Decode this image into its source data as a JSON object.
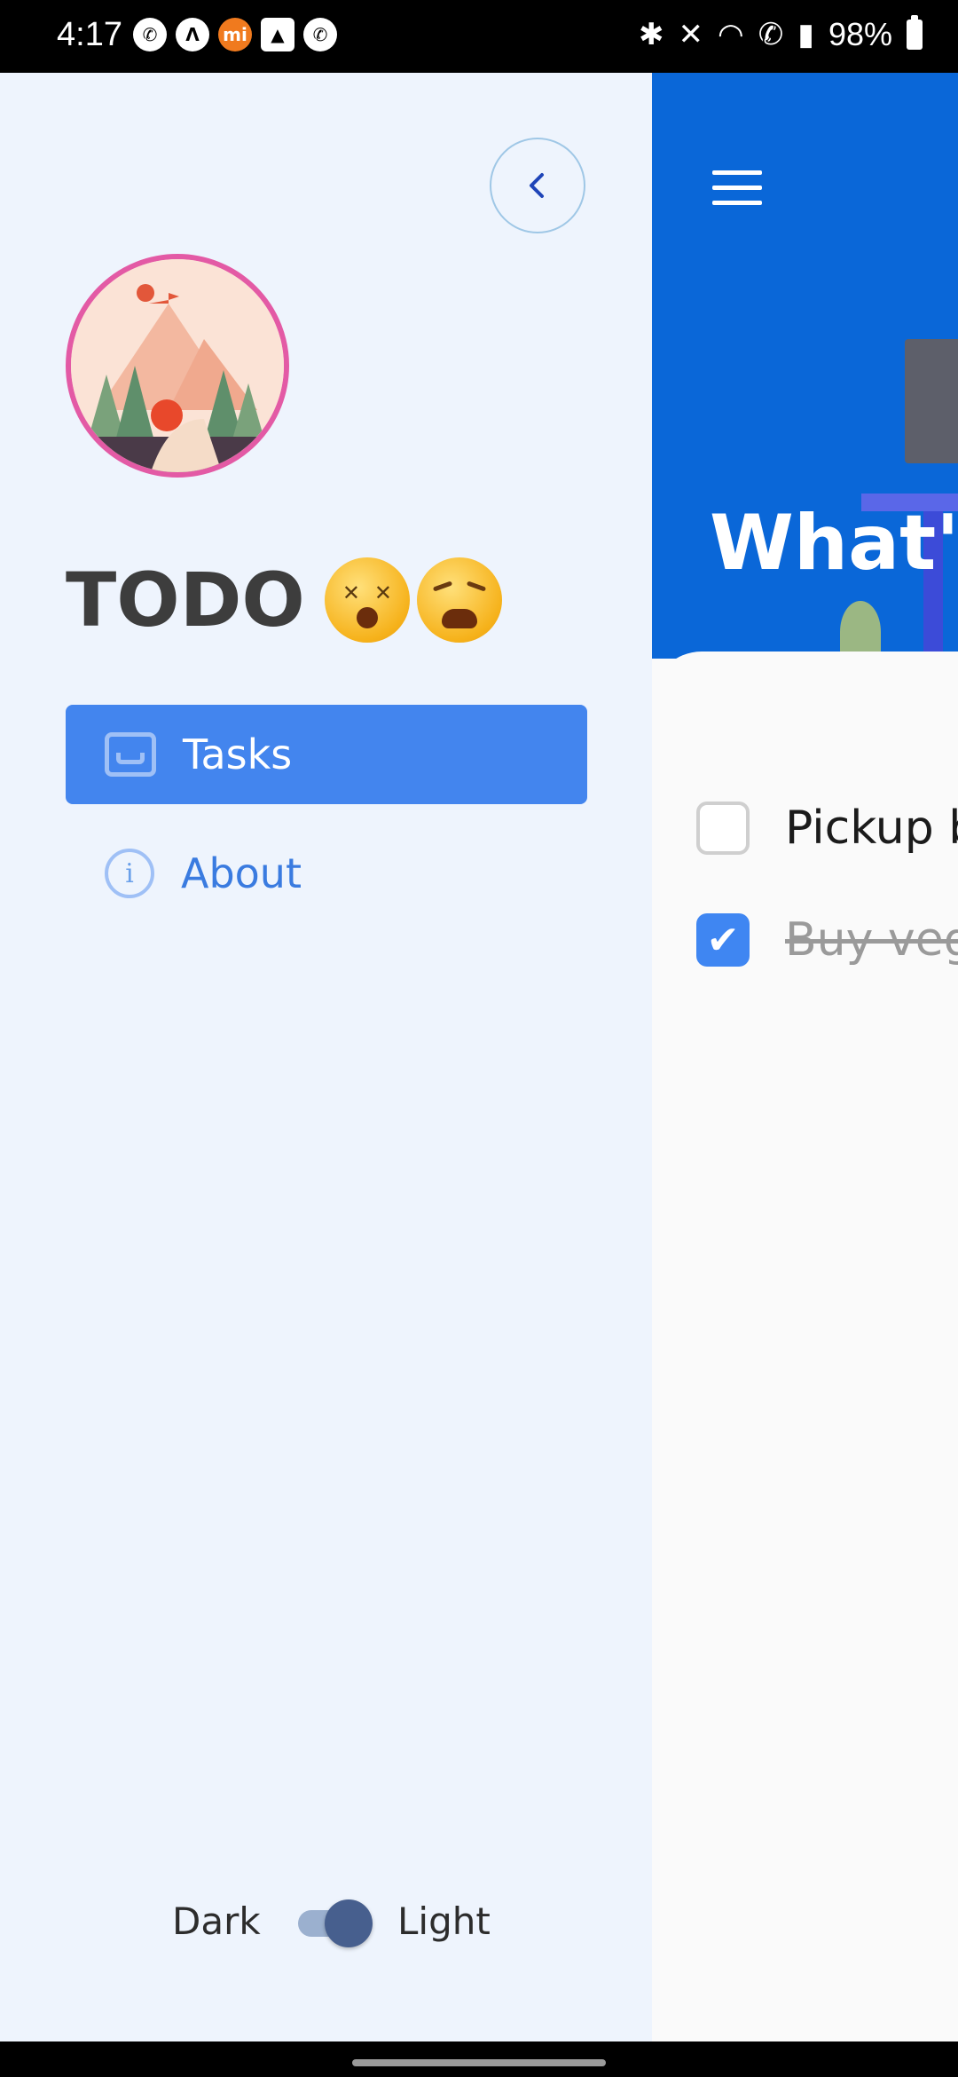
{
  "status_bar": {
    "time": "4:17",
    "battery": "98%",
    "left_icons": [
      "whatsapp-icon",
      "app-icon",
      "mi-icon",
      "gallery-icon",
      "phone-icon"
    ],
    "right_icons": [
      "bluetooth-icon",
      "mute-icon",
      "wifi-icon",
      "wifi-call-icon",
      "signal-icon",
      "battery-icon"
    ]
  },
  "drawer": {
    "title": "TODO",
    "emojis": [
      "dizzy-face-emoji",
      "weary-face-emoji"
    ],
    "back_icon": "chevron-left-icon",
    "nav": [
      {
        "label": "Tasks",
        "icon": "inbox-icon",
        "active": true
      },
      {
        "label": "About",
        "icon": "info-icon",
        "active": false
      }
    ],
    "theme": {
      "dark_label": "Dark",
      "light_label": "Light",
      "value": "light"
    }
  },
  "main": {
    "header_text": "What's",
    "tasks": [
      {
        "label": "Pickup b",
        "done": false
      },
      {
        "label": "Buy veg",
        "done": true
      }
    ]
  },
  "colors": {
    "accent": "#4385EE",
    "header_blue": "#0A67D8",
    "drawer_bg": "#EEF4FD",
    "avatar_border": "#E35AA5"
  }
}
